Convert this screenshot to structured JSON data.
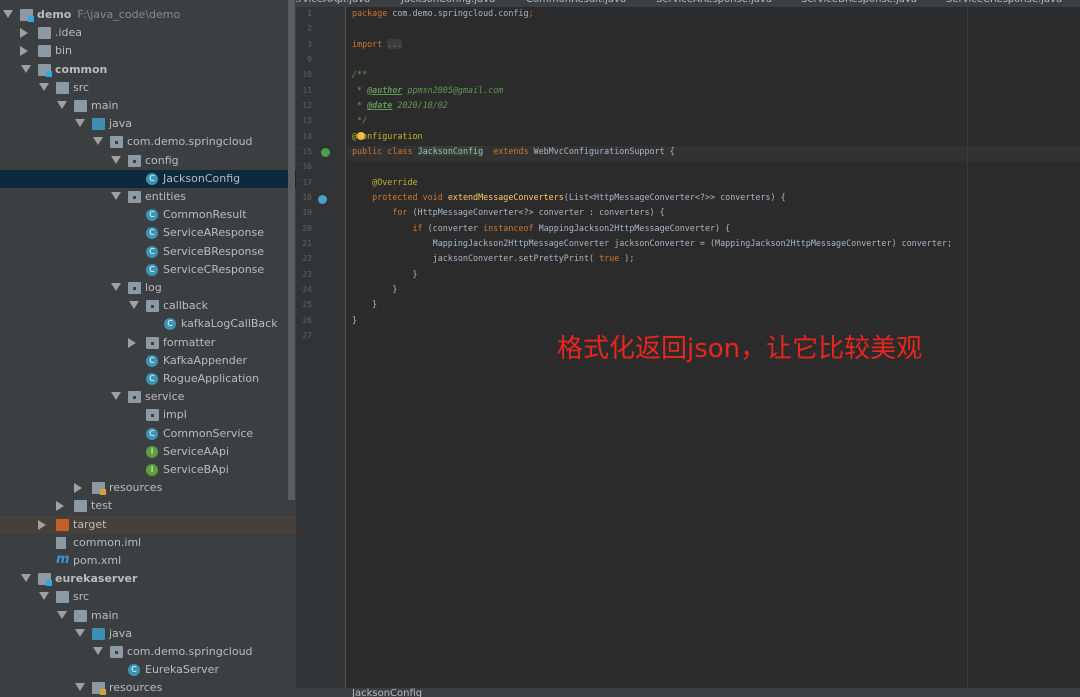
{
  "tree": [
    {
      "label": "demo",
      "bold": true,
      "path": "F:\\java_code\\demo",
      "level": 0,
      "arrow": "open",
      "icon": "module-folder"
    },
    {
      "label": ".idea",
      "level": 1,
      "arrow": "closed",
      "icon": "folder"
    },
    {
      "label": "bin",
      "level": 1,
      "arrow": "closed",
      "icon": "folder"
    },
    {
      "label": "common",
      "bold": true,
      "level": 1,
      "arrow": "open",
      "icon": "module-folder"
    },
    {
      "label": "src",
      "level": 2,
      "arrow": "open",
      "icon": "folder"
    },
    {
      "label": "main",
      "level": 3,
      "arrow": "open",
      "icon": "folder"
    },
    {
      "label": "java",
      "level": 4,
      "arrow": "open",
      "icon": "source-folder"
    },
    {
      "label": "com.demo.springcloud",
      "level": 5,
      "arrow": "open",
      "icon": "package"
    },
    {
      "label": "config",
      "level": 6,
      "arrow": "open",
      "icon": "package"
    },
    {
      "label": "JacksonConfig",
      "level": 7,
      "icon": "class",
      "selected": true
    },
    {
      "label": "entities",
      "level": 6,
      "arrow": "open",
      "icon": "package"
    },
    {
      "label": "CommonResult",
      "level": 7,
      "icon": "class"
    },
    {
      "label": "ServiceAResponse",
      "level": 7,
      "icon": "class"
    },
    {
      "label": "ServiceBResponse",
      "level": 7,
      "icon": "class"
    },
    {
      "label": "ServiceCResponse",
      "level": 7,
      "icon": "class"
    },
    {
      "label": "log",
      "level": 6,
      "arrow": "open",
      "icon": "package"
    },
    {
      "label": "callback",
      "level": 7,
      "arrow": "open",
      "icon": "package"
    },
    {
      "label": "kafkaLogCallBack",
      "level": 8,
      "icon": "class"
    },
    {
      "label": "formatter",
      "level": 7,
      "arrow": "closed",
      "icon": "package"
    },
    {
      "label": "KafkaAppender",
      "level": 7,
      "icon": "class"
    },
    {
      "label": "RogueApplication",
      "level": 7,
      "icon": "class"
    },
    {
      "label": "service",
      "level": 6,
      "arrow": "open",
      "icon": "package"
    },
    {
      "label": "impl",
      "level": 7,
      "icon": "package"
    },
    {
      "label": "CommonService",
      "level": 7,
      "icon": "class"
    },
    {
      "label": "ServiceAApi",
      "level": 7,
      "icon": "interface"
    },
    {
      "label": "ServiceBApi",
      "level": 7,
      "icon": "interface"
    },
    {
      "label": "resources",
      "level": 4,
      "arrow": "closed",
      "icon": "resources-folder"
    },
    {
      "label": "test",
      "level": 3,
      "arrow": "closed",
      "icon": "folder"
    },
    {
      "label": "target",
      "level": 2,
      "arrow": "closed",
      "icon": "excluded-folder",
      "excluded": true
    },
    {
      "label": "common.iml",
      "level": 2,
      "icon": "iml-file"
    },
    {
      "label": "pom.xml",
      "level": 2,
      "icon": "maven-file"
    },
    {
      "label": "eurekaserver",
      "bold": true,
      "level": 1,
      "arrow": "open",
      "icon": "module-folder"
    },
    {
      "label": "src",
      "level": 2,
      "arrow": "open",
      "icon": "folder"
    },
    {
      "label": "main",
      "level": 3,
      "arrow": "open",
      "icon": "folder"
    },
    {
      "label": "java",
      "level": 4,
      "arrow": "open",
      "icon": "source-folder"
    },
    {
      "label": "com.demo.springcloud",
      "level": 5,
      "arrow": "open",
      "icon": "package"
    },
    {
      "label": "EurekaServer",
      "level": 6,
      "icon": "spring-class"
    },
    {
      "label": "resources",
      "level": 4,
      "arrow": "open",
      "icon": "resources-folder"
    }
  ],
  "tabs": [
    "ServiceAApi.java",
    "JacksonConfig.java",
    "CommonResult.java",
    "ServiceAResponse.java",
    "ServiceBResponse.java",
    "ServiceCResponse.java"
  ],
  "code": [
    {
      "n": "1",
      "t": [
        [
          "package ",
          "kw"
        ],
        [
          "com.demo.springcloud.config",
          ""
        ],
        [
          ";",
          "kw"
        ]
      ]
    },
    {
      "n": "2",
      "t": []
    },
    {
      "n": "3",
      "t": [
        [
          "import ",
          "kw"
        ],
        [
          "...",
          "fold"
        ]
      ]
    },
    {
      "n": "9",
      "t": []
    },
    {
      "n": "10",
      "t": [
        [
          "/**",
          "cm"
        ]
      ]
    },
    {
      "n": "11",
      "t": [
        [
          " * ",
          "cm"
        ],
        [
          "@author",
          "tag"
        ],
        [
          " ppmsn2005@gmail.com",
          "cm"
        ]
      ]
    },
    {
      "n": "12",
      "t": [
        [
          " * ",
          "cm"
        ],
        [
          "@date",
          "tag"
        ],
        [
          " 2020/10/02",
          "cm"
        ]
      ]
    },
    {
      "n": "13",
      "t": [
        [
          " */",
          "cm"
        ]
      ]
    },
    {
      "n": "14",
      "t": [
        [
          "@Configuration",
          "an"
        ]
      ]
    },
    {
      "n": "15",
      "t": [
        [
          "public class ",
          "kw"
        ],
        [
          "JacksonConfig",
          "hl"
        ],
        [
          "  extends ",
          "kw"
        ],
        [
          "WebMvcConfigurationSupport {",
          ""
        ]
      ]
    },
    {
      "n": "16",
      "t": []
    },
    {
      "n": "17",
      "t": [
        [
          "    @Override",
          "an"
        ]
      ]
    },
    {
      "n": "18",
      "t": [
        [
          "    protected void ",
          "kw"
        ],
        [
          "extendMessageConverters",
          "fn"
        ],
        [
          "(List<HttpMessageConverter<?>> converters) {",
          ""
        ]
      ]
    },
    {
      "n": "19",
      "t": [
        [
          "        for ",
          "kw"
        ],
        [
          "(HttpMessageConverter<?> converter : converters) {",
          ""
        ]
      ]
    },
    {
      "n": "20",
      "t": [
        [
          "            if ",
          "kw"
        ],
        [
          "(converter ",
          ""
        ],
        [
          "instanceof ",
          "kw"
        ],
        [
          "MappingJackson2HttpMessageConverter) {",
          ""
        ]
      ]
    },
    {
      "n": "21",
      "t": [
        [
          "                MappingJackson2HttpMessageConverter jacksonConverter = (MappingJackson2HttpMessageConverter) converter;",
          ""
        ]
      ]
    },
    {
      "n": "22",
      "t": [
        [
          "                jacksonConverter.setPrettyPrint( ",
          ""
        ],
        [
          "true",
          "kw"
        ],
        [
          " );",
          ""
        ]
      ]
    },
    {
      "n": "23",
      "t": [
        [
          "            }",
          ""
        ]
      ]
    },
    {
      "n": "24",
      "t": [
        [
          "        }",
          ""
        ]
      ]
    },
    {
      "n": "25",
      "t": [
        [
          "    }",
          ""
        ]
      ]
    },
    {
      "n": "26",
      "t": [
        [
          "}",
          ""
        ]
      ]
    },
    {
      "n": "27",
      "t": []
    }
  ],
  "annotation": "格式化返回json，让它比较美观",
  "breadcrumb": "JacksonConfig",
  "colors": {
    "accent": "#3b93b5",
    "annotation": "#e8261e",
    "keyword": "#cc7832",
    "selection": "#0d293e"
  }
}
